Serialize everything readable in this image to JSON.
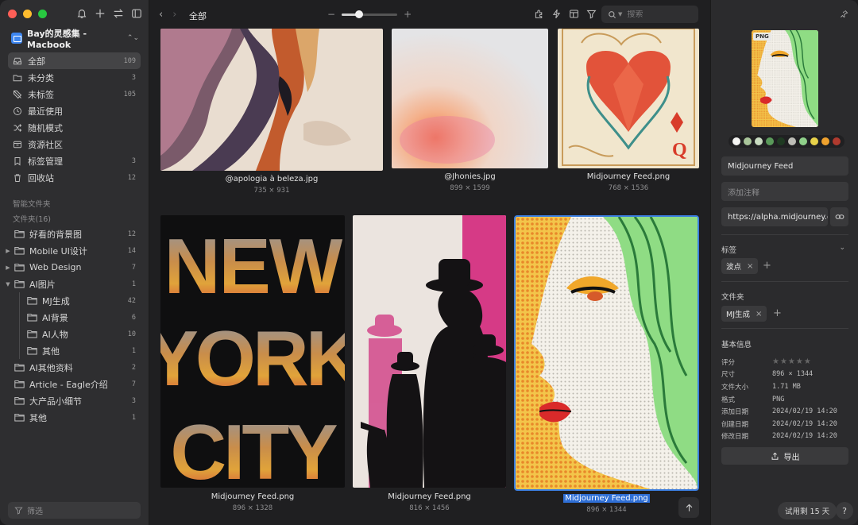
{
  "sidebar": {
    "library_name": "Bay的灵感集 - Macbook",
    "nav": [
      {
        "label": "全部",
        "count": "109",
        "icon": "inbox-icon"
      },
      {
        "label": "未分类",
        "count": "3",
        "icon": "folder-question-icon"
      },
      {
        "label": "未标签",
        "count": "105",
        "icon": "tag-off-icon"
      },
      {
        "label": "最近使用",
        "count": "",
        "icon": "clock-icon"
      },
      {
        "label": "随机模式",
        "count": "",
        "icon": "shuffle-icon"
      },
      {
        "label": "资源社区",
        "count": "",
        "icon": "community-icon"
      },
      {
        "label": "标签管理",
        "count": "3",
        "icon": "bookmark-icon"
      },
      {
        "label": "回收站",
        "count": "12",
        "icon": "trash-icon"
      }
    ],
    "smart_folders_label": "智能文件夹",
    "folders_label": "文件夹(16)",
    "folders": [
      {
        "label": "好看的背景图",
        "count": "12",
        "arrow": ""
      },
      {
        "label": "Mobile UI设计",
        "count": "14",
        "arrow": "▶"
      },
      {
        "label": "Web Design",
        "count": "7",
        "arrow": "▶"
      },
      {
        "label": "AI图片",
        "count": "1",
        "arrow": "▼"
      },
      {
        "label": "MJ生成",
        "count": "42",
        "arrow": ""
      },
      {
        "label": "AI背景",
        "count": "6",
        "arrow": ""
      },
      {
        "label": "AI人物",
        "count": "10",
        "arrow": ""
      },
      {
        "label": "其他",
        "count": "1",
        "arrow": ""
      },
      {
        "label": "AI其他资料",
        "count": "2",
        "arrow": ""
      },
      {
        "label": "Article - Eagle介绍",
        "count": "7",
        "arrow": ""
      },
      {
        "label": "大产品小细节",
        "count": "3",
        "arrow": ""
      },
      {
        "label": "其他",
        "count": "1",
        "arrow": ""
      }
    ],
    "filter_placeholder": "筛选"
  },
  "toolbar": {
    "breadcrumb": "全部",
    "zoom_minus": "−",
    "zoom_plus": "+",
    "zoom_level": 0.32,
    "search_placeholder": "搜索"
  },
  "grid": {
    "items": [
      {
        "name": "@apologia à beleza.jpg",
        "dims": "735 × 931"
      },
      {
        "name": "@Jhonies.jpg",
        "dims": "899 × 1599"
      },
      {
        "name": "Midjourney Feed.png",
        "dims": "768 × 1536"
      },
      {
        "name": "Midjourney Feed.png",
        "dims": "896 × 1328"
      },
      {
        "name": "Midjourney Feed.png",
        "dims": "816 × 1456"
      },
      {
        "name": "Midjourney Feed.png",
        "dims": "896 × 1344"
      }
    ]
  },
  "inspector": {
    "badge": "PNG",
    "palette": [
      "#f4f4f2",
      "#a9c59a",
      "#c9dcc1",
      "#5a9a5a",
      "#1f3a22",
      "#bdbdb6",
      "#8fd08a",
      "#e8d24a",
      "#f0a22e",
      "#b03a2e"
    ],
    "name": "Midjourney Feed",
    "note_placeholder": "添加注释",
    "url": "https://alpha.midjourney.com",
    "tags_label": "标签",
    "tags": [
      "波点"
    ],
    "folders_label": "文件夹",
    "folders": [
      "MJ生成"
    ],
    "info_label": "基本信息",
    "rating_label": "评分",
    "rating": 0,
    "info": [
      {
        "k": "尺寸",
        "v": "896 × 1344"
      },
      {
        "k": "文件大小",
        "v": "1.71 MB"
      },
      {
        "k": "格式",
        "v": "PNG"
      },
      {
        "k": "添加日期",
        "v": "2024/02/19 14:20"
      },
      {
        "k": "创建日期",
        "v": "2024/02/19 14:20"
      },
      {
        "k": "修改日期",
        "v": "2024/02/19 14:20"
      }
    ],
    "export_label": "导出",
    "trial_label": "试用剩 15 天",
    "help_label": "?"
  }
}
